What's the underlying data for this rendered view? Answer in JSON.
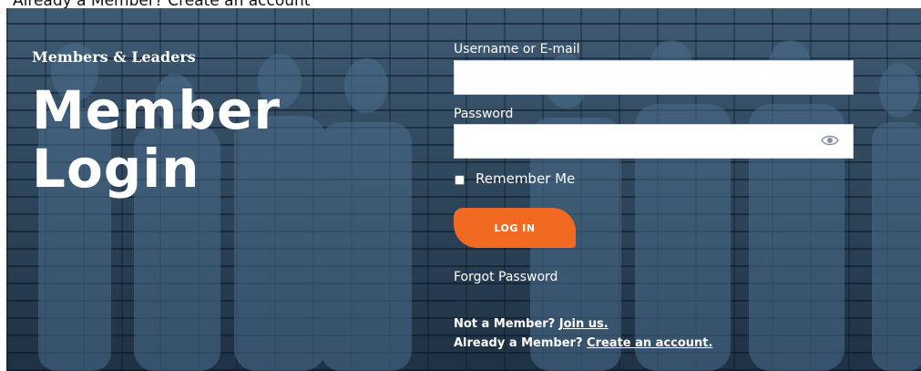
{
  "header": {
    "clipped_text": "Already a Member? Create an account"
  },
  "hero": {
    "brand": "Members & Leaders",
    "title_line1": "Member",
    "title_line2": "Login"
  },
  "form": {
    "username_label": "Username or E-mail",
    "username_value": "",
    "password_label": "Password",
    "password_value": "",
    "remember_label": "Remember Me",
    "login_label": "LOG IN",
    "forgot_label": "Forgot Password"
  },
  "footer": {
    "not_member_text": "Not a Member?",
    "join_link": "Join us.",
    "already_member_text": "Already a Member?",
    "create_link": "Create an account."
  },
  "colors": {
    "accent": "#f26a21",
    "overlay": "#2d4459"
  },
  "icons": {
    "password_toggle": "eye-icon"
  }
}
